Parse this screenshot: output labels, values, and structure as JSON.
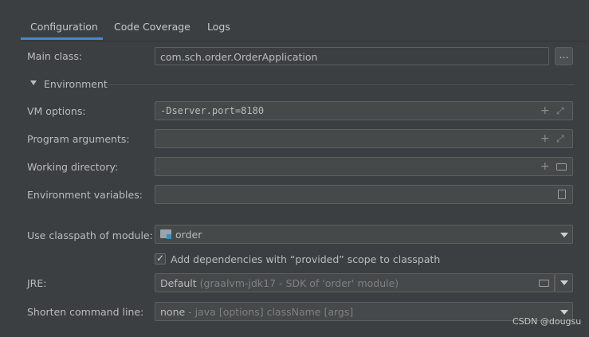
{
  "tabs": [
    {
      "label": "Configuration",
      "active": true
    },
    {
      "label": "Code Coverage",
      "active": false
    },
    {
      "label": "Logs",
      "active": false
    }
  ],
  "form": {
    "main_class": {
      "label": "Main class:",
      "value": "com.sch.order.OrderApplication",
      "browse_label": "..."
    },
    "environment_section": {
      "label": "Environment",
      "expanded": true
    },
    "vm_options": {
      "label": "VM options:",
      "value": "-Dserver.port=8180"
    },
    "program_arguments": {
      "label": "Program arguments:",
      "value": ""
    },
    "working_directory": {
      "label": "Working directory:",
      "value": ""
    },
    "environment_variables": {
      "label": "Environment variables:",
      "value": ""
    },
    "classpath_module": {
      "label": "Use classpath of module:",
      "value": "order"
    },
    "add_dependencies": {
      "label": "Add dependencies with “provided” scope to classpath",
      "checked": true
    },
    "jre": {
      "label": "JRE:",
      "value": "Default",
      "hint": "(graalvm-jdk17 - SDK of 'order' module)"
    },
    "shorten_command_line": {
      "label": "Shorten command line:",
      "value": "none",
      "hint": "- java [options] className [args]"
    }
  },
  "watermark": "CSDN @dougsu",
  "colors": {
    "accent": "#4a88c7",
    "background": "#3c3f41",
    "field": "#45494a",
    "text": "#bbbbbb"
  }
}
